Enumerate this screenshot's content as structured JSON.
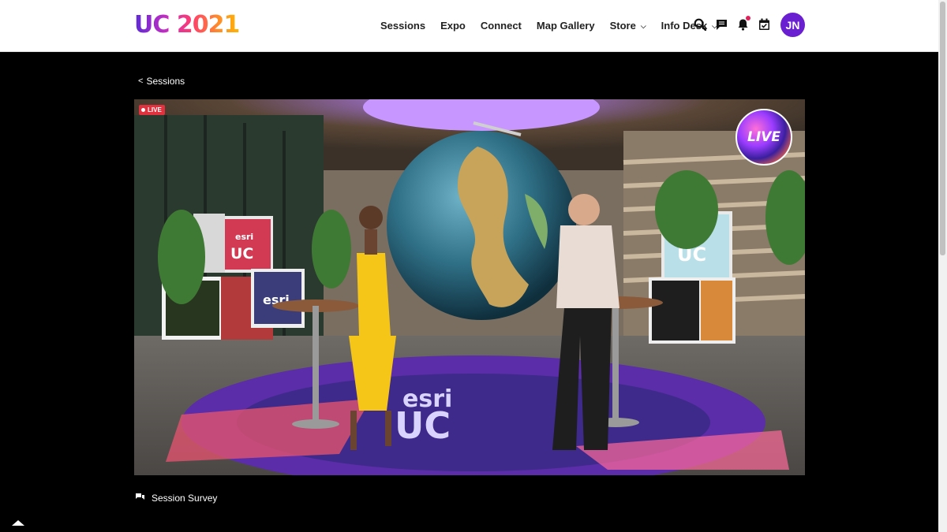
{
  "header": {
    "logo_text": "UC 2021",
    "nav": [
      {
        "label": "Sessions",
        "dropdown": false
      },
      {
        "label": "Expo",
        "dropdown": false
      },
      {
        "label": "Connect",
        "dropdown": false
      },
      {
        "label": "Map Gallery",
        "dropdown": false
      },
      {
        "label": "Store",
        "dropdown": true
      },
      {
        "label": "Info Desk",
        "dropdown": true
      }
    ],
    "icons": [
      "search-icon",
      "chat-icon",
      "bell-icon",
      "calendar-icon"
    ],
    "avatar_initials": "JN"
  },
  "back_link": {
    "label": "Sessions"
  },
  "video": {
    "live_badge": "LIVE",
    "live_logo_text": "LIVE",
    "scene_signage": [
      "esri",
      "UC"
    ]
  },
  "survey": {
    "label": "Session Survey"
  },
  "colors": {
    "brand_purple": "#6a1fd1",
    "live_red": "#e0323e",
    "notification": "#e0215a",
    "background": "#000000"
  }
}
